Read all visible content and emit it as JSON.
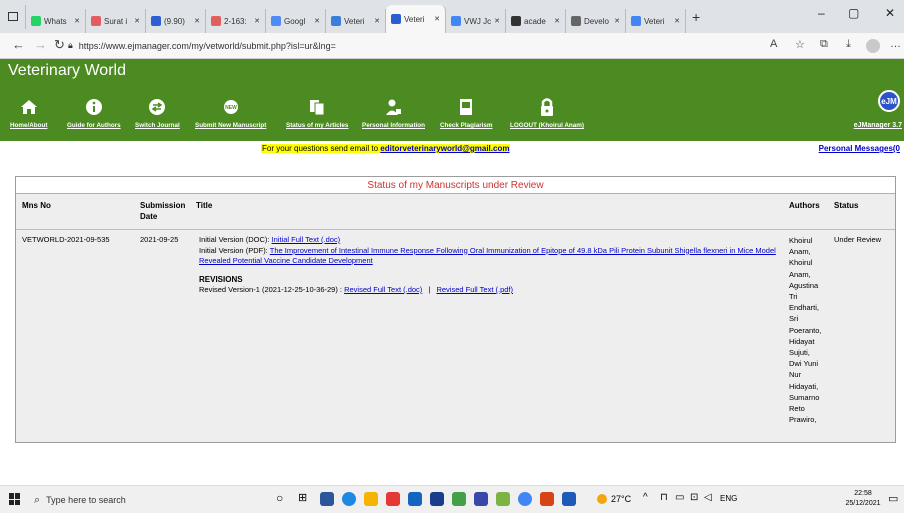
{
  "browser": {
    "tabs": [
      {
        "label": "Whats",
        "color": "#25d366"
      },
      {
        "label": "Surat i",
        "color": "#e25d5d"
      },
      {
        "label": "(9.90)",
        "color": "#2d5fd3"
      },
      {
        "label": "2-163:",
        "color": "#e25d5d"
      },
      {
        "label": "Googl",
        "color": "#4e8bf5"
      },
      {
        "label": "Veteri",
        "color": "#3b7dd8"
      },
      {
        "label": "Veteri",
        "color": "#2b5fd0"
      },
      {
        "label": "VWJ Jc",
        "color": "#4285f4"
      },
      {
        "label": "acade",
        "color": "#333333"
      },
      {
        "label": "Develo",
        "color": "#666666"
      },
      {
        "label": "Veteri",
        "color": "#4285f4"
      }
    ],
    "url": "https://www.ejmanager.com/my/vetworld/submit.php?isl=ur&lng="
  },
  "site": {
    "title": "Veterinary World",
    "menu": [
      {
        "label": "Home/About",
        "icon": "home-icon"
      },
      {
        "label": "Guide for Authors",
        "icon": "info-icon"
      },
      {
        "label": "Switch Journal",
        "icon": "switch-icon"
      },
      {
        "label": "Submit New Manuscript",
        "icon": "new-icon"
      },
      {
        "label": "Status of my Articles",
        "icon": "documents-icon"
      },
      {
        "label": "Personal Information",
        "icon": "person-icon"
      },
      {
        "label": "Check Plagiarism",
        "icon": "check-icon"
      },
      {
        "label": "LOGOUT (Khoirul Anam)",
        "icon": "lock-icon"
      }
    ],
    "badge": "eJM",
    "badge_label": "eJManager 3.7"
  },
  "emailbar": {
    "prefix": "For your questions send email to ",
    "email": "editorveterinaryworld@gmail.com",
    "personal_messages": "Personal Messages(0"
  },
  "table": {
    "title": "Status of my Manuscripts under Review",
    "headers": {
      "mns_no": "Mns No",
      "submission_date": "Submission Date",
      "title": "Title",
      "authors": "Authors",
      "status": "Status"
    },
    "row": {
      "mns_no": "VETWORLD-2021-09-535",
      "date": "2021-09-25",
      "doc_prefix": "Initial Version (DOC): ",
      "doc_link": "Initial Full Text (.doc)",
      "pdf_prefix": "Initial Version (PDF): ",
      "pdf_link": "The Improvement of Intestinal Immune Response Following Oral Immunization of Epitope of 49.8 kDa Pili Protein Subunit Shigella flexneri in Mice Model Revealed Potential Vaccine Candidate Development",
      "revisions_heading": "REVISIONS",
      "revision_prefix": "Revised Version-1 (2021-12-25-10-36-29) : ",
      "revision_doc_link": "Revised Full Text (.doc)",
      "revision_sep": " | ",
      "revision_pdf_link": "Revised Full Text (.pdf)",
      "authors": [
        "Khoirul",
        "Anam,",
        "Khoirul",
        "Anam,",
        "Agustina",
        "Tri",
        "Endharti,",
        "Sri",
        "Poeranto,",
        "Hidayat",
        "Sujuti,",
        "Dwi Yuni",
        "Nur",
        "Hidayati,",
        "Sumarno",
        "Reto",
        "Prawiro,"
      ],
      "status": "Under Review"
    }
  },
  "taskbar": {
    "search_placeholder": "Type here to search",
    "weather": "27°C",
    "lang": "ENG",
    "time": "22:58",
    "date": "25/12/2021"
  }
}
